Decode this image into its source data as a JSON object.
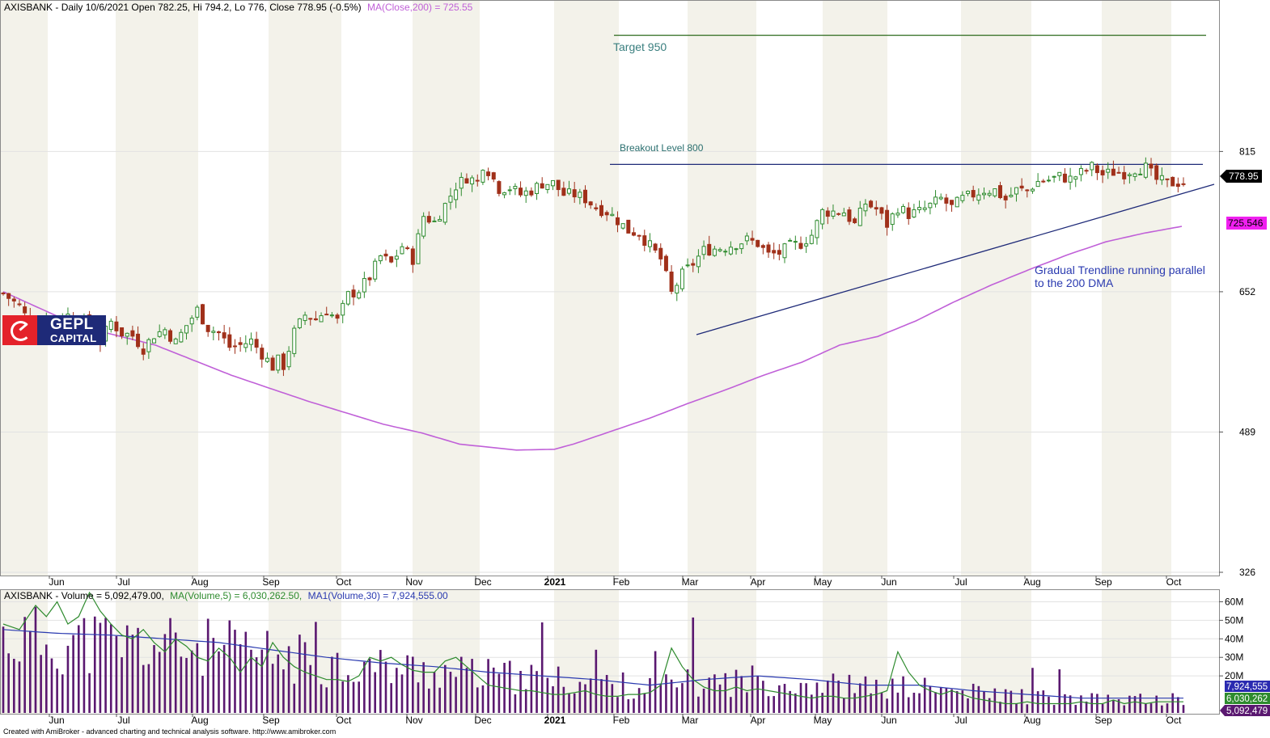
{
  "header": {
    "price_title": "AXISBANK - Daily 10/6/2021 Open 782.25, Hi 794.2, Lo 776, Close 778.95 (-0.5%)",
    "ma_title": "MA(Close,200) = 725.55",
    "vol_title": "AXISBANK - Volume = 5,092,479.00,",
    "vol_ma5_title": "MA(Volume,5) = 6,030,262.50,",
    "vol_ma30_title": "MA1(Volume,30) = 7,924,555.00"
  },
  "footer": "Created with AmiBroker - advanced charting and technical analysis software. http://www.amibroker.com",
  "logo": {
    "line1": "GEPL",
    "line2": "CAPITAL"
  },
  "colors": {
    "up": "#2e8b2e",
    "down": "#a0301a",
    "ma": "#c060d8",
    "trend": "#1e2a78",
    "target": "#2e6b1e",
    "vol_bar": "#5a1870",
    "vol_ma5": "#2e8b2e",
    "vol_ma30": "#2a3ab0"
  },
  "chart_data": [
    {
      "type": "candlestick",
      "x_ticks": [
        "Jun",
        "Jul",
        "Aug",
        "Sep",
        "Oct",
        "Nov",
        "Dec",
        "2021",
        "Feb",
        "Mar",
        "Apr",
        "May",
        "Jun",
        "Jul",
        "Aug",
        "Sep",
        "Oct"
      ],
      "y_ticks": [
        815,
        652,
        489,
        326
      ],
      "ylim": [
        326,
        960
      ],
      "last_close": {
        "label": "778.95",
        "value": 778.95
      },
      "ma200_value": {
        "label": "725.546",
        "value": 725.546
      },
      "annotations": [
        {
          "text": "Target 950",
          "value": 950
        },
        {
          "text": "Breakout Level 800",
          "value": 800
        },
        {
          "text": "Gradual Trendline running parallel",
          "text2": "to the 200 DMA"
        }
      ],
      "close_path": [
        [
          0,
          650
        ],
        [
          3,
          635
        ],
        [
          6,
          605
        ],
        [
          8,
          628
        ],
        [
          9,
          600
        ],
        [
          11,
          626
        ],
        [
          14,
          622
        ],
        [
          16,
          610
        ],
        [
          18,
          595
        ],
        [
          20,
          617
        ],
        [
          22,
          604
        ],
        [
          24,
          601
        ],
        [
          26,
          586
        ],
        [
          28,
          602
        ],
        [
          30,
          608
        ],
        [
          32,
          593
        ],
        [
          34,
          613
        ],
        [
          36,
          631
        ],
        [
          38,
          610
        ],
        [
          40,
          604
        ],
        [
          42,
          588
        ],
        [
          44,
          590
        ],
        [
          46,
          595
        ],
        [
          48,
          580
        ],
        [
          50,
          565
        ],
        [
          51,
          572
        ],
        [
          52,
          566
        ],
        [
          54,
          605
        ],
        [
          56,
          625
        ],
        [
          58,
          620
        ],
        [
          60,
          631
        ],
        [
          62,
          618
        ],
        [
          64,
          648
        ],
        [
          66,
          654
        ],
        [
          68,
          669
        ],
        [
          70,
          693
        ],
        [
          72,
          685
        ],
        [
          74,
          705
        ],
        [
          76,
          690
        ],
        [
          78,
          740
        ],
        [
          80,
          733
        ],
        [
          82,
          753
        ],
        [
          84,
          775
        ],
        [
          86,
          785
        ],
        [
          88,
          780
        ],
        [
          89,
          800
        ],
        [
          90,
          793
        ],
        [
          92,
          772
        ],
        [
          94,
          773
        ],
        [
          96,
          765
        ],
        [
          98,
          770
        ],
        [
          100,
          778
        ],
        [
          102,
          778
        ],
        [
          104,
          765
        ],
        [
          106,
          765
        ],
        [
          108,
          760
        ],
        [
          110,
          750
        ],
        [
          112,
          745
        ],
        [
          114,
          735
        ],
        [
          116,
          723
        ],
        [
          118,
          720
        ],
        [
          120,
          705
        ],
        [
          122,
          690
        ],
        [
          124,
          650
        ],
        [
          126,
          672
        ],
        [
          128,
          685
        ],
        [
          130,
          700
        ],
        [
          132,
          702
        ],
        [
          134,
          704
        ],
        [
          136,
          708
        ],
        [
          138,
          712
        ],
        [
          140,
          708
        ],
        [
          142,
          695
        ],
        [
          144,
          697
        ],
        [
          146,
          705
        ],
        [
          148,
          708
        ],
        [
          150,
          718
        ],
        [
          152,
          745
        ],
        [
          154,
          745
        ],
        [
          156,
          745
        ],
        [
          158,
          730
        ],
        [
          160,
          755
        ],
        [
          162,
          748
        ],
        [
          164,
          730
        ],
        [
          166,
          750
        ],
        [
          168,
          742
        ],
        [
          170,
          745
        ],
        [
          172,
          752
        ],
        [
          174,
          760
        ],
        [
          176,
          750
        ],
        [
          178,
          760
        ],
        [
          180,
          765
        ],
        [
          182,
          770
        ],
        [
          184,
          770
        ],
        [
          186,
          759
        ],
        [
          188,
          770
        ],
        [
          190,
          770
        ],
        [
          192,
          780
        ],
        [
          194,
          782
        ],
        [
          196,
          786
        ],
        [
          198,
          783
        ],
        [
          200,
          790
        ],
        [
          202,
          797
        ],
        [
          204,
          788
        ],
        [
          206,
          791
        ],
        [
          208,
          790
        ],
        [
          210,
          795
        ],
        [
          212,
          796
        ],
        [
          214,
          782
        ],
        [
          216,
          778
        ],
        [
          218,
          779
        ]
      ],
      "ma200": [
        [
          0,
          652
        ],
        [
          20,
          612
        ],
        [
          40,
          590
        ],
        [
          60,
          555
        ],
        [
          80,
          525
        ],
        [
          100,
          498
        ],
        [
          110,
          488
        ],
        [
          120,
          475
        ],
        [
          135,
          468
        ],
        [
          145,
          469
        ],
        [
          150,
          475
        ],
        [
          160,
          490
        ],
        [
          170,
          505
        ],
        [
          180,
          522
        ],
        [
          190,
          538
        ],
        [
          200,
          555
        ],
        [
          210,
          570
        ],
        [
          220,
          590
        ],
        [
          230,
          600
        ],
        [
          240,
          618
        ],
        [
          250,
          640
        ],
        [
          260,
          660
        ],
        [
          270,
          678
        ],
        [
          280,
          695
        ],
        [
          290,
          710
        ],
        [
          300,
          720
        ],
        [
          310,
          728
        ]
      ]
    },
    {
      "type": "bar",
      "series": [
        "Volume",
        "MA(Volume,5)",
        "MA1(Volume,30)"
      ],
      "y_ticks": [
        "60M",
        "50M",
        "40M",
        "30M",
        "20M"
      ],
      "y_values": [
        60000000,
        50000000,
        40000000,
        30000000,
        20000000
      ],
      "ylim": [
        0,
        65000000
      ],
      "last_values": [
        {
          "label": "7,924,555",
          "value": 7924555
        },
        {
          "label": "6,030,262",
          "value": 6030262
        },
        {
          "label": "5,092,479",
          "value": 5092479
        }
      ],
      "ma5_path": [
        [
          0,
          48
        ],
        [
          3,
          45
        ],
        [
          6,
          58
        ],
        [
          8,
          52
        ],
        [
          10,
          60
        ],
        [
          12,
          48
        ],
        [
          14,
          52
        ],
        [
          16,
          65
        ],
        [
          18,
          55
        ],
        [
          20,
          48
        ],
        [
          22,
          42
        ],
        [
          24,
          40
        ],
        [
          26,
          45
        ],
        [
          28,
          38
        ],
        [
          30,
          33
        ],
        [
          32,
          40
        ],
        [
          34,
          36
        ],
        [
          36,
          30
        ],
        [
          38,
          28
        ],
        [
          40,
          35
        ],
        [
          42,
          30
        ],
        [
          44,
          22
        ],
        [
          46,
          30
        ],
        [
          48,
          25
        ],
        [
          50,
          38
        ],
        [
          52,
          30
        ],
        [
          54,
          25
        ],
        [
          56,
          22
        ],
        [
          58,
          20
        ],
        [
          60,
          18
        ],
        [
          62,
          18
        ],
        [
          64,
          17
        ],
        [
          66,
          20
        ],
        [
          68,
          30
        ],
        [
          70,
          28
        ],
        [
          72,
          30
        ],
        [
          74,
          26
        ],
        [
          76,
          23
        ],
        [
          78,
          22
        ],
        [
          80,
          22
        ],
        [
          82,
          28
        ],
        [
          84,
          30
        ],
        [
          86,
          25
        ],
        [
          88,
          20
        ],
        [
          90,
          15
        ],
        [
          92,
          14
        ],
        [
          94,
          13
        ],
        [
          96,
          12
        ],
        [
          98,
          12
        ],
        [
          100,
          11
        ],
        [
          102,
          10
        ],
        [
          104,
          10
        ],
        [
          106,
          11
        ],
        [
          108,
          12
        ],
        [
          110,
          10
        ],
        [
          112,
          9
        ],
        [
          114,
          9
        ],
        [
          116,
          10
        ],
        [
          118,
          10
        ],
        [
          120,
          11
        ],
        [
          122,
          15
        ],
        [
          124,
          35
        ],
        [
          126,
          25
        ],
        [
          128,
          18
        ],
        [
          130,
          14
        ],
        [
          132,
          12
        ],
        [
          134,
          12
        ],
        [
          136,
          14
        ],
        [
          138,
          12
        ],
        [
          140,
          13
        ],
        [
          142,
          12
        ],
        [
          144,
          11
        ],
        [
          146,
          10
        ],
        [
          148,
          9
        ],
        [
          150,
          8
        ],
        [
          152,
          9
        ],
        [
          154,
          9
        ],
        [
          156,
          8
        ],
        [
          158,
          8
        ],
        [
          160,
          9
        ],
        [
          162,
          10
        ],
        [
          164,
          12
        ],
        [
          166,
          33
        ],
        [
          168,
          22
        ],
        [
          170,
          15
        ],
        [
          172,
          12
        ],
        [
          174,
          10
        ],
        [
          176,
          12
        ],
        [
          178,
          10
        ],
        [
          180,
          8
        ],
        [
          182,
          7
        ],
        [
          184,
          6
        ],
        [
          186,
          5
        ],
        [
          188,
          5
        ],
        [
          190,
          6
        ],
        [
          192,
          5
        ],
        [
          194,
          5
        ],
        [
          196,
          5
        ],
        [
          198,
          5
        ],
        [
          200,
          6
        ],
        [
          202,
          5
        ],
        [
          204,
          5
        ],
        [
          206,
          7
        ],
        [
          208,
          5
        ],
        [
          210,
          6
        ],
        [
          212,
          5
        ],
        [
          214,
          6
        ],
        [
          216,
          6
        ],
        [
          218,
          6
        ]
      ],
      "ma30_path": [
        [
          0,
          45
        ],
        [
          10,
          43
        ],
        [
          20,
          42
        ],
        [
          30,
          40
        ],
        [
          40,
          38
        ],
        [
          50,
          34
        ],
        [
          60,
          30
        ],
        [
          70,
          27
        ],
        [
          80,
          25
        ],
        [
          90,
          22
        ],
        [
          100,
          20
        ],
        [
          110,
          18
        ],
        [
          120,
          15
        ],
        [
          130,
          18
        ],
        [
          140,
          20
        ],
        [
          150,
          18
        ],
        [
          160,
          15
        ],
        [
          170,
          15
        ],
        [
          180,
          12
        ],
        [
          190,
          10
        ],
        [
          200,
          8
        ],
        [
          210,
          8
        ],
        [
          218,
          8
        ]
      ]
    }
  ]
}
